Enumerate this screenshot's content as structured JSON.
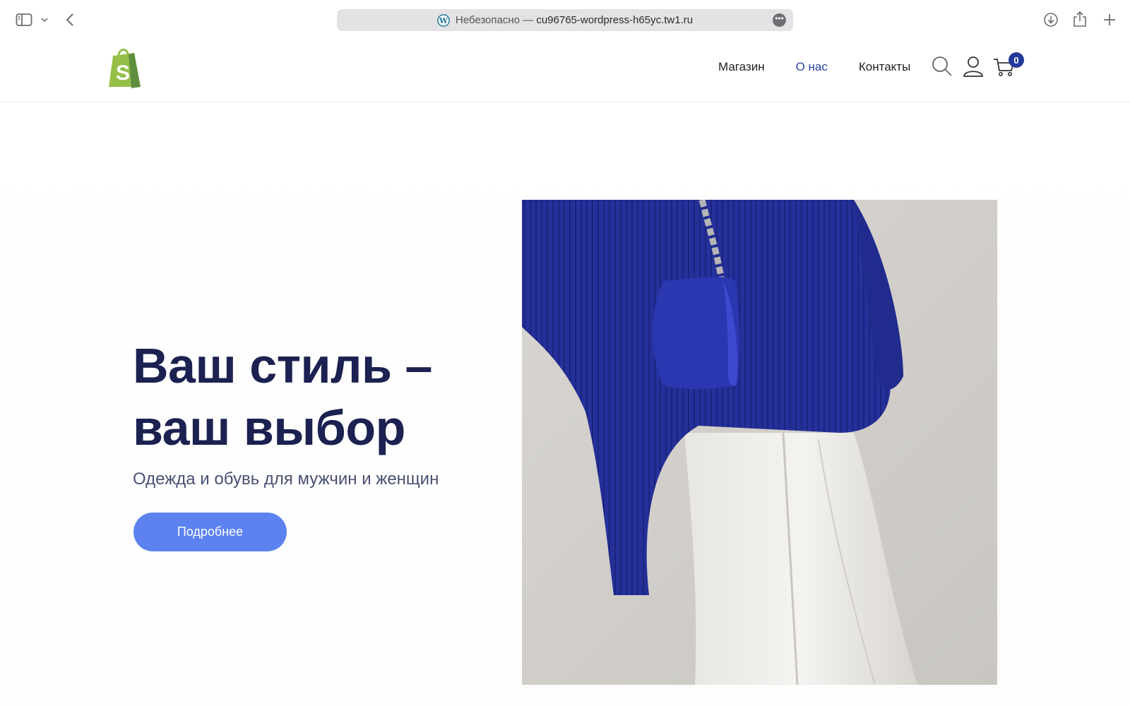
{
  "browser": {
    "url_prefix": "Небезопасно —",
    "url_host": "cu96765-wordpress-h65yc.tw1.ru",
    "more_label": "•••"
  },
  "header": {
    "nav": [
      {
        "label": "Магазин",
        "active": false
      },
      {
        "label": "О нас",
        "active": true
      },
      {
        "label": "Контакты",
        "active": false
      }
    ],
    "cart_count": "0"
  },
  "hero": {
    "title_line1": "Ваш стиль –",
    "title_line2": "ваш выбор",
    "subtitle": "Одежда и обувь для мужчин и женщин",
    "button_label": "Подробнее"
  },
  "colors": {
    "accent": "#5b82ee",
    "heading": "#1b2150",
    "nav_active": "#2b44a6",
    "badge": "#23399a",
    "logo_green": "#95bf47"
  },
  "icons": [
    "sidebar-icon",
    "chevron-down-icon",
    "back-icon",
    "wordpress-icon",
    "more-icon",
    "download-icon",
    "share-icon",
    "plus-icon",
    "shopify-logo",
    "search-icon",
    "user-icon",
    "cart-icon"
  ]
}
